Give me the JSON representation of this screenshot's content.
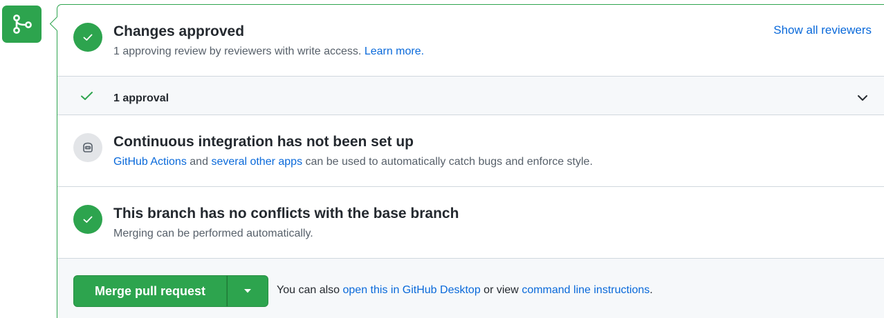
{
  "approved": {
    "title": "Changes approved",
    "desc_prefix": "1 approving review by reviewers with write access.",
    "desc_link": "Learn more.",
    "show_all": "Show all reviewers"
  },
  "approvals": {
    "label": "1 approval"
  },
  "ci": {
    "title": "Continuous integration has not been set up",
    "link1": "GitHub Actions",
    "mid": "and",
    "link2": "several other apps",
    "rest": "can be used to automatically catch bugs and enforce style."
  },
  "conflicts": {
    "title": "This branch has no conflicts with the base branch",
    "desc": "Merging can be performed automatically."
  },
  "merge": {
    "button_label": "Merge pull request",
    "text_prefix": "You can also",
    "link1": "open this in GitHub Desktop",
    "mid": "or view",
    "link2": "command line instructions",
    "suffix": "."
  },
  "colors": {
    "success": "#2da44e",
    "link": "#0969da",
    "muted": "#57606a"
  },
  "icons": {
    "merge_state": "git-merge-icon",
    "approved": "check-circle-icon",
    "approvals": "check-icon",
    "expand": "chevron-down-icon",
    "ci": "robot-icon",
    "conflicts": "check-circle-icon",
    "dropdown": "triangle-down-icon"
  }
}
